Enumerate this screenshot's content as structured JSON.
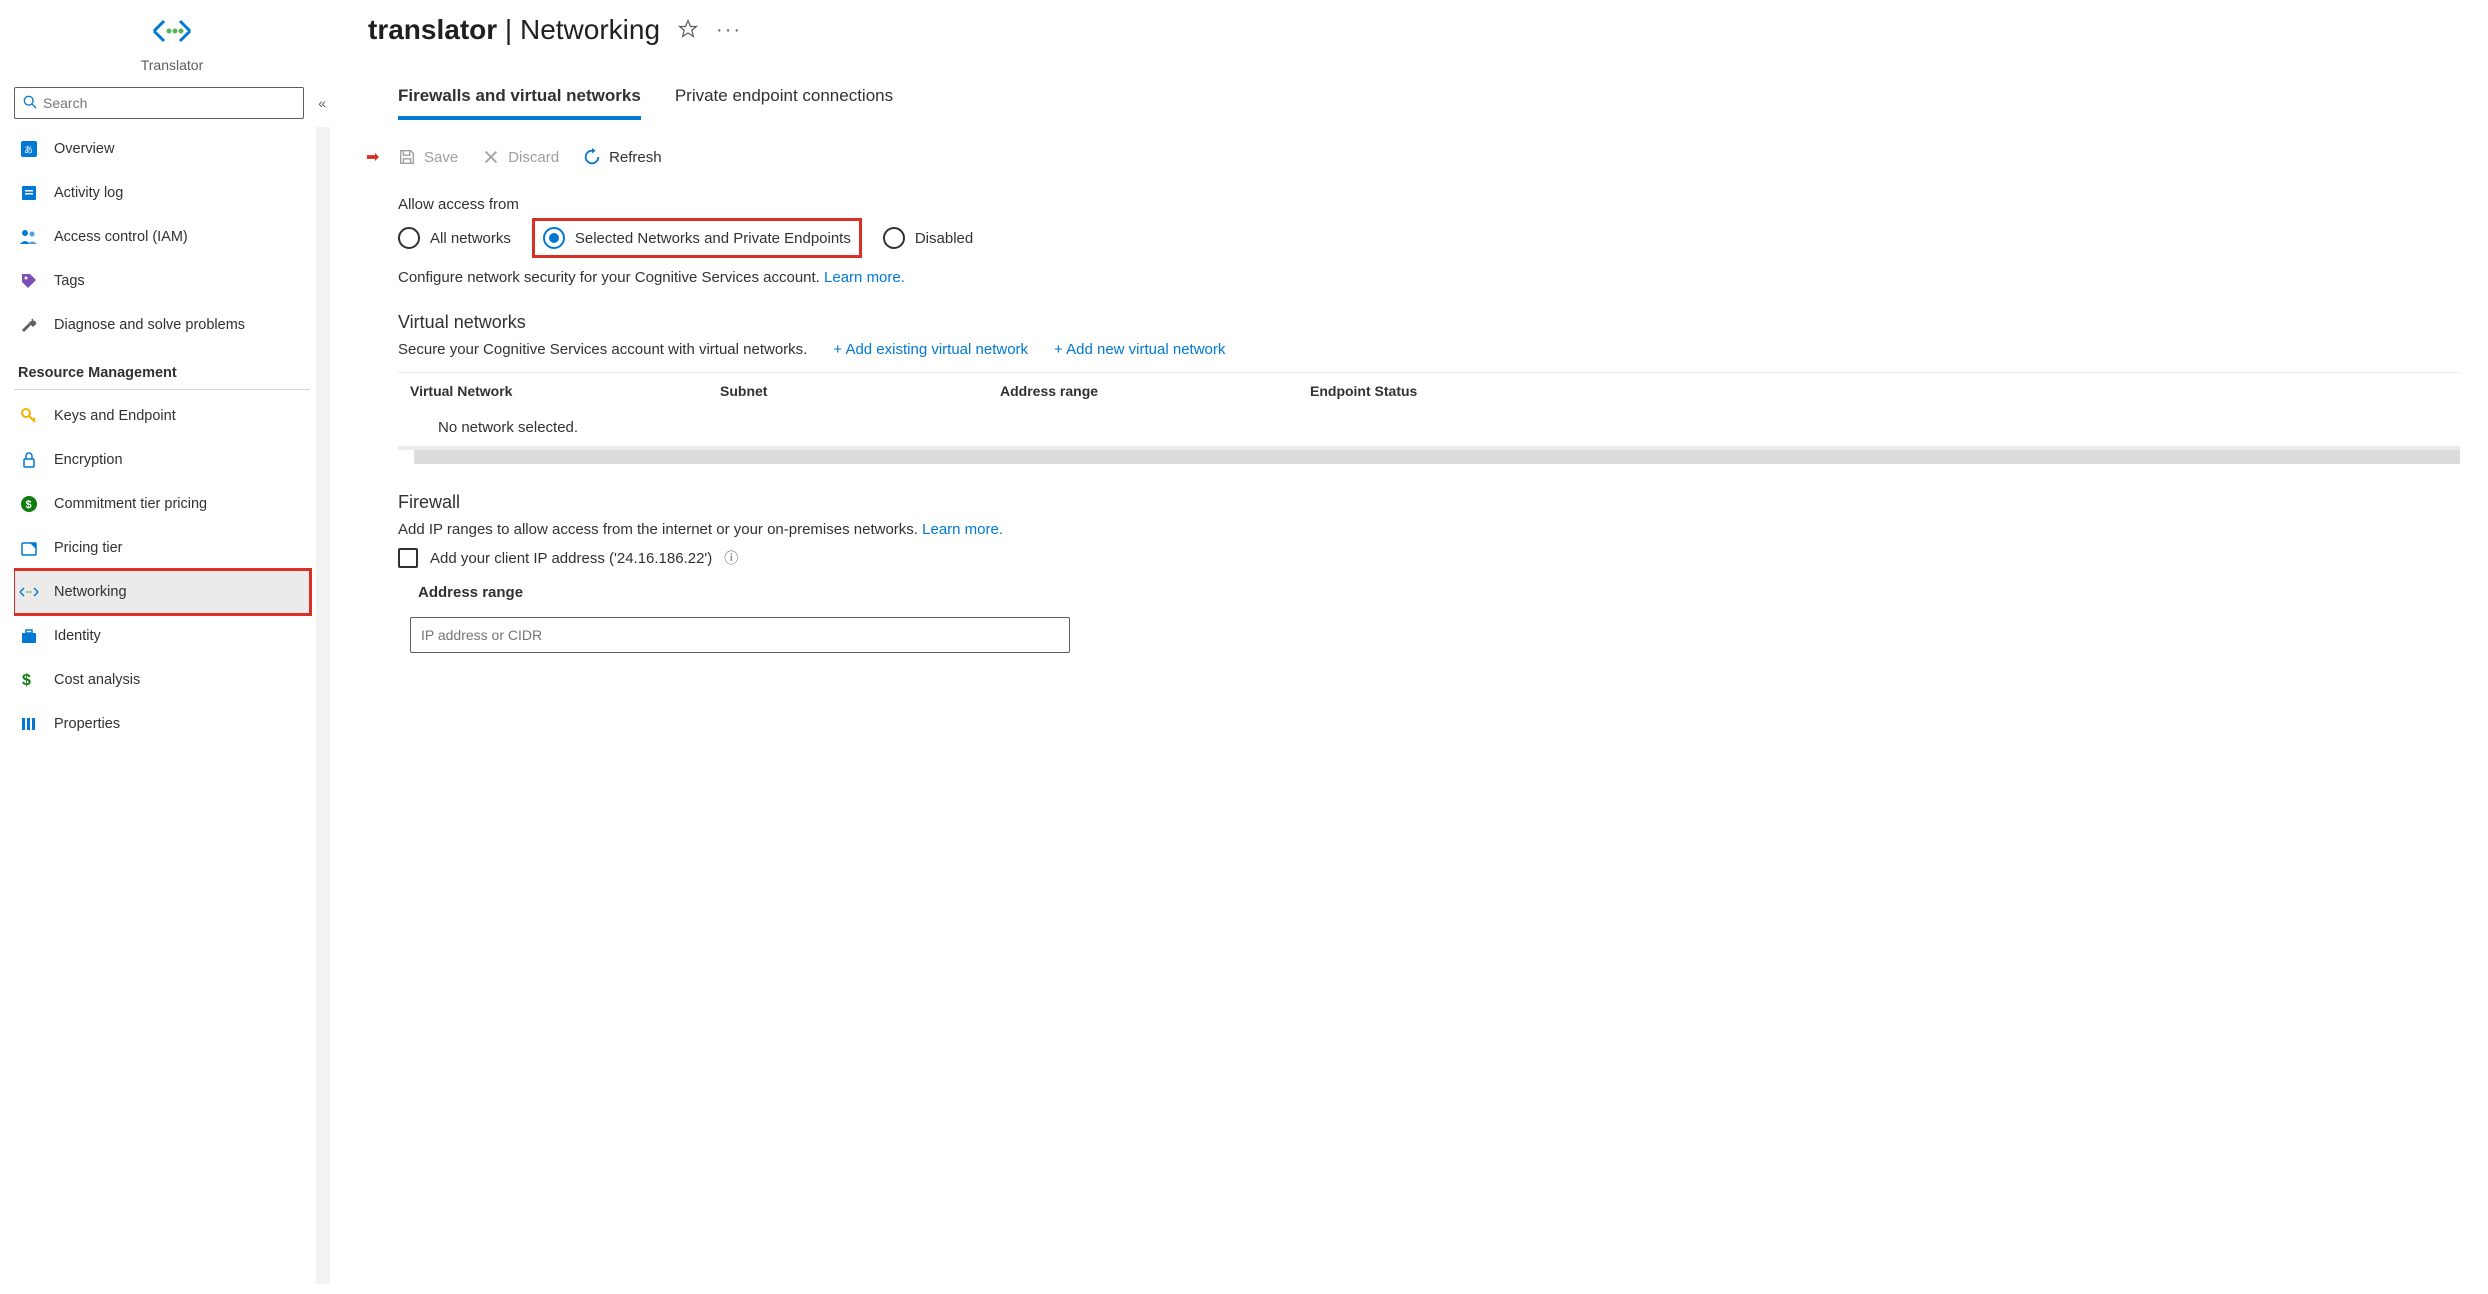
{
  "sidebar": {
    "resourceType": "Translator",
    "searchPlaceholder": "Search",
    "items": [
      {
        "label": "Overview"
      },
      {
        "label": "Activity log"
      },
      {
        "label": "Access control (IAM)"
      },
      {
        "label": "Tags"
      },
      {
        "label": "Diagnose and solve problems"
      }
    ],
    "sectionResourceMgmt": "Resource Management",
    "rm": [
      {
        "label": "Keys and Endpoint"
      },
      {
        "label": "Encryption"
      },
      {
        "label": "Commitment tier pricing"
      },
      {
        "label": "Pricing tier"
      },
      {
        "label": "Networking"
      },
      {
        "label": "Identity"
      },
      {
        "label": "Cost analysis"
      },
      {
        "label": "Properties"
      }
    ]
  },
  "header": {
    "titleBold": "translator",
    "titleRest": " | Networking"
  },
  "tabs": {
    "firewalls": "Firewalls and virtual networks",
    "private": "Private endpoint connections"
  },
  "toolbar": {
    "save": "Save",
    "discard": "Discard",
    "refresh": "Refresh"
  },
  "access": {
    "label": "Allow access from",
    "all": "All networks",
    "selected": "Selected Networks and Private Endpoints",
    "disabled": "Disabled",
    "desc": "Configure network security for your Cognitive Services account. ",
    "learn": "Learn more."
  },
  "vnet": {
    "title": "Virtual networks",
    "desc": "Secure your Cognitive Services account with virtual networks.",
    "addExisting": "+ Add existing virtual network",
    "addNew": "+ Add new virtual network",
    "colVN": "Virtual Network",
    "colSubnet": "Subnet",
    "colAddr": "Address range",
    "colEndpoint": "Endpoint Status",
    "empty": "No network selected."
  },
  "firewall": {
    "title": "Firewall",
    "desc": "Add IP ranges to allow access from the internet or your on-premises networks. ",
    "learn": "Learn more.",
    "addClient": "Add your client IP address ('24.16.186.22')",
    "addrLabel": "Address range",
    "ipPlaceholder": "IP address or CIDR"
  }
}
